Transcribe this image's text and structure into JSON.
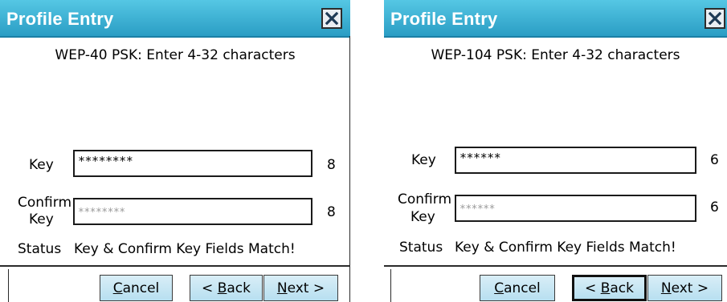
{
  "panels": [
    {
      "title": "Profile Entry",
      "hint": "WEP-40 PSK: Enter 4-32 characters",
      "key_label": "Key",
      "key_value": "********",
      "key_count": "8",
      "confirm_label_1": "Confirm",
      "confirm_label_2": "Key",
      "confirm_value": "********",
      "confirm_count": "8",
      "status_label": "Status",
      "status_text": "Key & Confirm Key Fields Match!",
      "cancel": {
        "mn": "C",
        "rest": "ancel"
      },
      "back": {
        "pre": "< ",
        "mn": "B",
        "rest": "ack"
      },
      "next": {
        "mn": "N",
        "rest": "ext >"
      }
    },
    {
      "title": "Profile Entry",
      "hint": "WEP-104 PSK: Enter 4-32 characters",
      "key_label": "Key",
      "key_value": "******",
      "key_count": "6",
      "confirm_label_1": "Confirm",
      "confirm_label_2": "Key",
      "confirm_value": "******",
      "confirm_count": "6",
      "status_label": "Status",
      "status_text": "Key & Confirm Key Fields Match!",
      "cancel": {
        "mn": "C",
        "rest": "ancel"
      },
      "back": {
        "pre": "< ",
        "mn": "B",
        "rest": "ack"
      },
      "next": {
        "mn": "N",
        "rest": "ext >"
      }
    }
  ],
  "colors": {
    "titlebar": "#2a9dc4",
    "button": "#b7dff0"
  },
  "icons": {
    "close": "close-x-icon"
  }
}
